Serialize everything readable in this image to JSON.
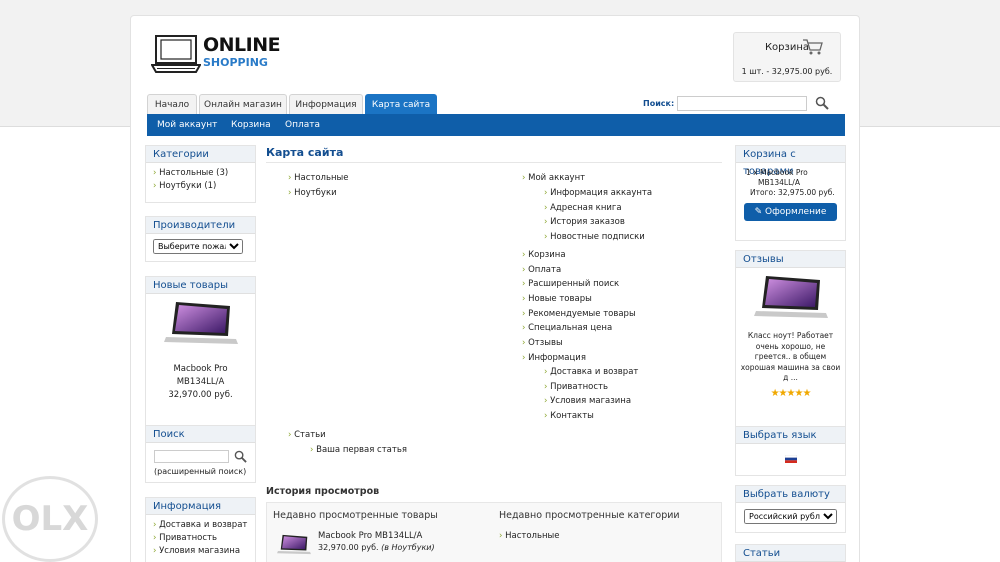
{
  "brand": {
    "line1": "ONLINE",
    "line2": "SHOPPING"
  },
  "cart_header": {
    "label": "Корзина",
    "summary": "1 шт. - 32,975.00 руб."
  },
  "tabs": [
    {
      "label": "Начало"
    },
    {
      "label": "Онлайн магазин"
    },
    {
      "label": "Информация"
    },
    {
      "label": "Карта сайта",
      "active": true
    }
  ],
  "search": {
    "label": "Поиск:",
    "value": ""
  },
  "subnav": [
    {
      "label": "Мой аккаунт"
    },
    {
      "label": "Корзина"
    },
    {
      "label": "Оплата"
    }
  ],
  "left": {
    "categories": {
      "title": "Категории",
      "items": [
        "Настольные (3)",
        "Ноутбуки (1)"
      ]
    },
    "manufacturers": {
      "title": "Производители",
      "select": "Выберите пожалуйс"
    },
    "new_products": {
      "title": "Новые товары",
      "name1": "Macbook Pro",
      "name2": "MB134LL/A",
      "price": "32,970.00 руб."
    },
    "search": {
      "title": "Поиск",
      "advanced": "(расширенный поиск)"
    },
    "info": {
      "title": "Информация",
      "items": [
        "Доставка и возврат",
        "Приватность",
        "Условия магазина"
      ]
    }
  },
  "center": {
    "title": "Карта сайта",
    "left_links": [
      "Настольные",
      "Ноутбуки"
    ],
    "account": {
      "label": "Мой аккаунт",
      "sub": [
        "Информация аккаунта",
        "Адресная книга",
        "История заказов",
        "Новостные подписки"
      ]
    },
    "links": [
      "Корзина",
      "Оплата",
      "Расширенный поиск",
      "Новые товары",
      "Рекомендуемые товары",
      "Специальная цена",
      "Отзывы"
    ],
    "information": {
      "label": "Информация",
      "sub": [
        "Доставка и возврат",
        "Приватность",
        "Условия магазина",
        "Контакты"
      ]
    },
    "articles": {
      "label": "Статьи",
      "sub": [
        "Ваша первая статья"
      ]
    },
    "history": {
      "title": "История просмотров",
      "products_title": "Недавно просмотренные товары",
      "product_name": "Macbook Pro MB134LL/A",
      "product_price": "32,970.00 руб.",
      "product_cat": "(в Ноутбуки)",
      "categories_title": "Недавно просмотренные категории",
      "category": "Настольные"
    }
  },
  "right": {
    "cart": {
      "title": "Корзина с товарами",
      "line1": "1 x Macbook Pro",
      "line2": "MB134LL/A",
      "total": "Итого: 32,975.00 руб.",
      "button": "Оформление"
    },
    "reviews": {
      "title": "Отзывы",
      "text1": "Класс ноут! Работает",
      "text2": "очень хорошо, не",
      "text3": "греется.. в общем",
      "text4": "хорошая машина за свои",
      "text5": "д ...",
      "rating": 5
    },
    "language": {
      "title": "Выбрать язык"
    },
    "currency": {
      "title": "Выбрать валюту",
      "select": "Российский рубль"
    },
    "articles": {
      "title": "Статьи"
    }
  },
  "watermark": "OLX",
  "colors": {
    "accent": "#0f5ea9",
    "tab_active": "#1b74c4",
    "heading": "#134e90",
    "bullet": "#8ba52e"
  }
}
